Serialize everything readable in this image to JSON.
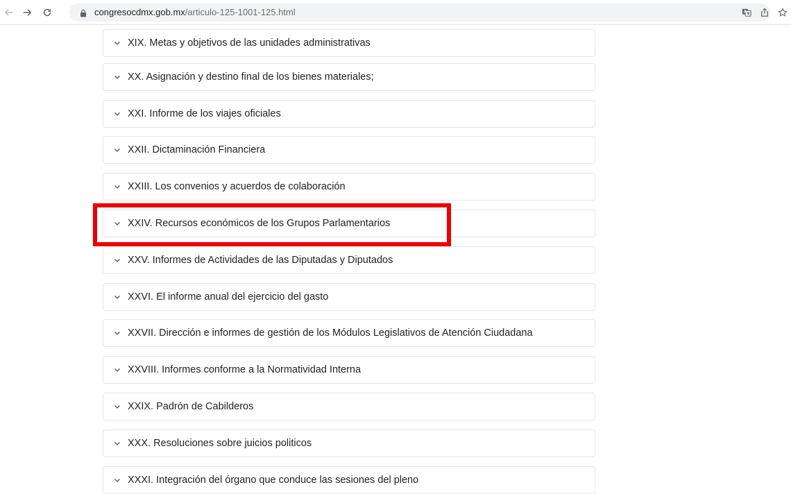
{
  "browser": {
    "url_host": "congresocdmx.gob.mx",
    "url_path": "/articulo-125-1001-125.html"
  },
  "accordion": {
    "items": [
      {
        "label": "XIX. Metas y objetivos de las unidades administrativas"
      },
      {
        "label": "XX. Asignación y destino final de los bienes materiales;"
      },
      {
        "label": "XXI. Informe de los viajes oficiales"
      },
      {
        "label": "XXII. Dictaminación Financiera"
      },
      {
        "label": "XXIII. Los convenios y acuerdos de colaboración"
      },
      {
        "label": "XXIV. Recursos económicos de los Grupos Parlamentarios"
      },
      {
        "label": "XXV. Informes de Actividades de las Diputadas y Diputados"
      },
      {
        "label": "XXVI. El informe anual del ejercicio del gasto"
      },
      {
        "label": "XXVII. Dirección e informes de gestión de los Módulos Legislativos de Atención Ciudadana"
      },
      {
        "label": "XXVIII. Informes conforme a la Normatividad Interna"
      },
      {
        "label": "XXIX. Padrón de Cabilderos"
      },
      {
        "label": "XXX. Resoluciones sobre juicios politicos"
      },
      {
        "label": "XXXI. Integración del órgano que conduce las sesiones del pleno"
      }
    ]
  },
  "annotation": {
    "color": "#ea0000"
  }
}
